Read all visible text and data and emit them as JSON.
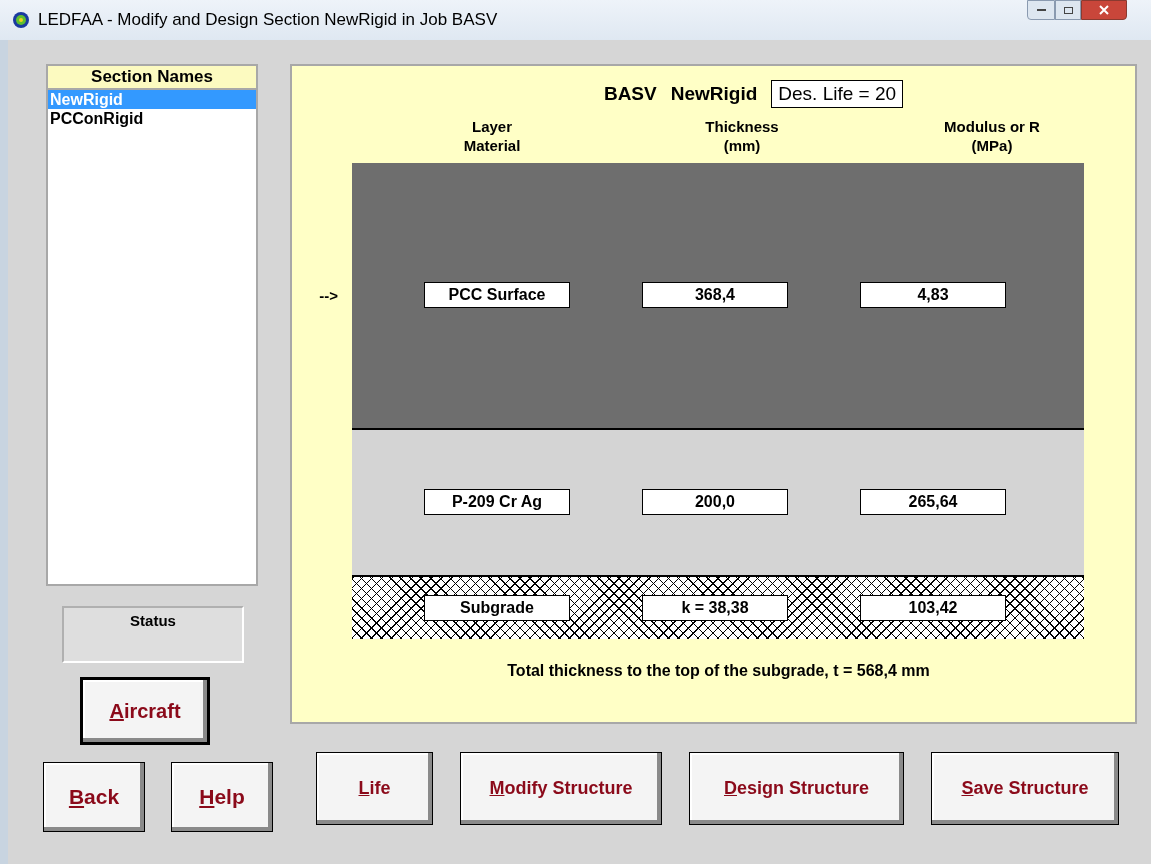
{
  "window": {
    "title": "LEDFAA - Modify and Design Section NewRigid in Job BASV"
  },
  "section_list": {
    "heading": "Section Names",
    "items": [
      {
        "label": "NewRigid",
        "selected": true
      },
      {
        "label": "PCConRigid",
        "selected": false
      }
    ]
  },
  "status": {
    "label": "Status"
  },
  "side_buttons": [
    {
      "accel": "A",
      "rest": "ircraft",
      "default": true
    },
    {
      "accel": "B",
      "rest": "ack",
      "default": false
    },
    {
      "accel": "H",
      "rest": "elp",
      "default": false
    }
  ],
  "header": {
    "job": "BASV",
    "section": "NewRigid",
    "design_life": "Des. Life = 20"
  },
  "columns": [
    {
      "line1": "Layer",
      "line2": "Material"
    },
    {
      "line1": "Thickness",
      "line2": "(mm)"
    },
    {
      "line1": "Modulus or R",
      "line2": "(MPa)"
    }
  ],
  "pointer": "-->",
  "layers": [
    {
      "kind": "surface",
      "selected": true,
      "material": "PCC Surface",
      "thickness": "368,4",
      "modulus": "4,83"
    },
    {
      "kind": "base",
      "selected": false,
      "material": "P-209 Cr Ag",
      "thickness": "200,0",
      "modulus": "265,64"
    },
    {
      "kind": "subgrade",
      "selected": false,
      "material": "Subgrade",
      "thickness": "k = 38,38",
      "modulus": "103,42"
    }
  ],
  "total": "Total thickness to the top of the subgrade, t = 568,4 mm",
  "bottom_buttons": [
    {
      "accel": "L",
      "rest": "ife"
    },
    {
      "accel": "M",
      "rest": "odify Structure"
    },
    {
      "accel": "D",
      "rest": "esign Structure"
    },
    {
      "accel": "S",
      "rest": "ave Structure"
    }
  ]
}
